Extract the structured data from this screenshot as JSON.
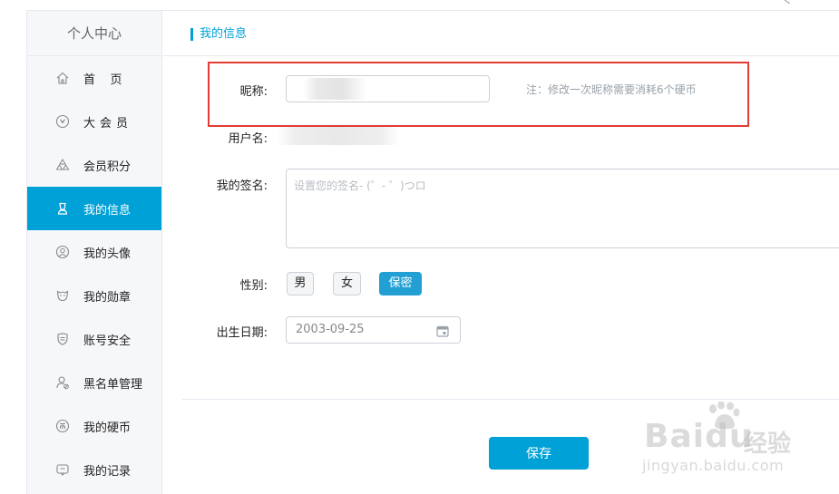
{
  "sidebar": {
    "title": "个人中心",
    "items": [
      {
        "label": "首    页",
        "icon": "home-icon"
      },
      {
        "label": "大会员",
        "icon": "vip-icon"
      },
      {
        "label": "会员积分",
        "icon": "points-icon"
      },
      {
        "label": "我的信息",
        "icon": "user-icon",
        "active": true
      },
      {
        "label": "我的头像",
        "icon": "avatar-icon"
      },
      {
        "label": "我的勋章",
        "icon": "medal-icon"
      },
      {
        "label": "账号安全",
        "icon": "shield-icon"
      },
      {
        "label": "黑名单管理",
        "icon": "blacklist-icon"
      },
      {
        "label": "我的硬币",
        "icon": "coin-icon"
      },
      {
        "label": "我的记录",
        "icon": "record-icon"
      }
    ]
  },
  "header": {
    "breadcrumb": "我的信息"
  },
  "form": {
    "nickname_label": "昵称:",
    "nickname_value": "",
    "nickname_note": "注：修改一次昵称需要消耗6个硬币",
    "username_label": "用户名:",
    "signature_label": "我的签名:",
    "signature_placeholder": "设置您的签名- (゜- ゜)つロ",
    "gender_label": "性别:",
    "gender_options": [
      "男",
      "女",
      "保密"
    ],
    "gender_selected": "保密",
    "birthday_label": "出生日期:",
    "birthday_value": "2003-09-25",
    "save_label": "保存"
  },
  "watermark": {
    "brand": "Baidu",
    "brand_cn": "经验",
    "url": "jingyan.baidu.com"
  },
  "colors": {
    "accent": "#00a1d6",
    "highlight_box": "#e23c35",
    "sidebar_bg": "#f6f7f9"
  }
}
